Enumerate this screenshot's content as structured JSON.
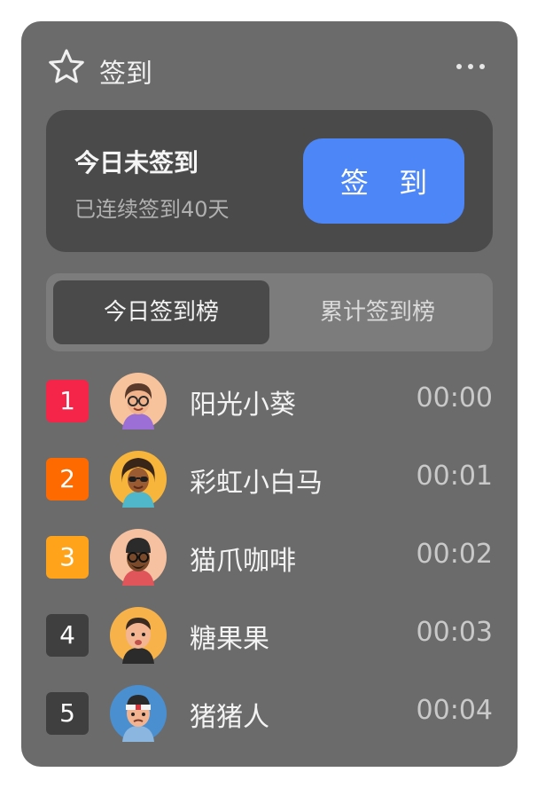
{
  "widget": {
    "title": "签到",
    "title_icon": "star-icon",
    "more_icon": "more-horizontal-icon"
  },
  "status": {
    "heading": "今日未签到",
    "streak": "已连续签到40天",
    "button_label": "签 到",
    "button_color": "#4d86f7"
  },
  "tabs": [
    {
      "label": "今日签到榜",
      "active": true
    },
    {
      "label": "累计签到榜",
      "active": false
    }
  ],
  "leaderboard": [
    {
      "rank": "1",
      "name": "阳光小葵",
      "time": "00:00",
      "badge_color": "#f5254a",
      "avatar": "avatar-woman-glasses-icon"
    },
    {
      "rank": "2",
      "name": "彩虹小白马",
      "time": "00:01",
      "badge_color": "#ff6a00",
      "avatar": "avatar-curly-hair-sunglasses-icon"
    },
    {
      "rank": "3",
      "name": "猫爪咖啡",
      "time": "00:02",
      "badge_color": "#ffa41a",
      "avatar": "avatar-man-beanie-icon"
    },
    {
      "rank": "4",
      "name": "糖果果",
      "time": "00:03",
      "badge_color": "#3f3f3f",
      "avatar": "avatar-boy-bald-icon"
    },
    {
      "rank": "5",
      "name": "猪猪人",
      "time": "00:04",
      "badge_color": "#3f3f3f",
      "avatar": "avatar-man-headband-icon"
    }
  ]
}
